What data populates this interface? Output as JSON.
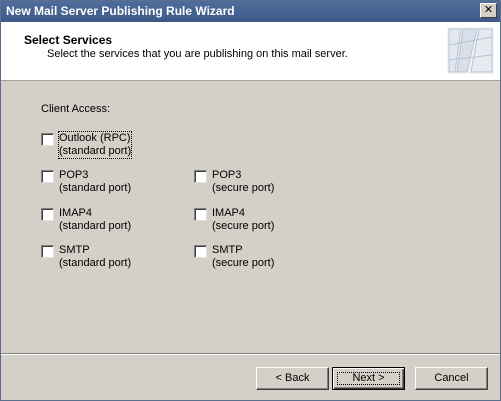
{
  "window": {
    "title": "New Mail Server Publishing Rule Wizard",
    "close_glyph": "✕"
  },
  "header": {
    "title": "Select Services",
    "subtitle": "Select the services that you are publishing on this mail server."
  },
  "client_access": {
    "label": "Client Access:",
    "options": [
      {
        "line1": "Outlook (RPC)",
        "line2": "(standard port)",
        "checked": false
      },
      {
        "line1": "POP3",
        "line2": "(standard port)",
        "checked": false
      },
      {
        "line1": "POP3",
        "line2": "(secure port)",
        "checked": false
      },
      {
        "line1": "IMAP4",
        "line2": "(standard port)",
        "checked": false
      },
      {
        "line1": "IMAP4",
        "line2": "(secure port)",
        "checked": false
      },
      {
        "line1": "SMTP",
        "line2": "(standard port)",
        "checked": false
      },
      {
        "line1": "SMTP",
        "line2": "(secure port)",
        "checked": false
      }
    ]
  },
  "buttons": {
    "back": "< Back",
    "next": "Next >",
    "cancel": "Cancel"
  },
  "icons": {
    "close": "close-icon",
    "wizard_graphic": "wizard-graphic-icon"
  }
}
